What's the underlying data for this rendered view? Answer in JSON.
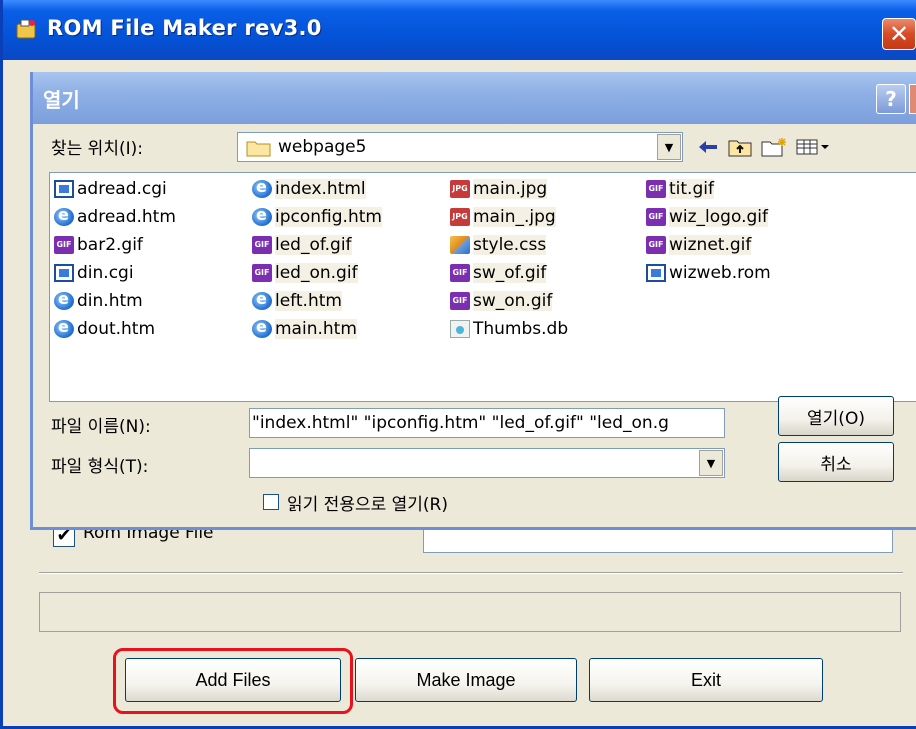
{
  "app": {
    "title": "ROM File Maker rev3.0"
  },
  "main": {
    "rom_image_label": "Rom Image File",
    "rom_image_checked": true,
    "rom_image_path": "",
    "status_text": "",
    "buttons": {
      "add_files": "Add Files",
      "make_image": "Make Image",
      "exit": "Exit"
    }
  },
  "dialog": {
    "title": "열기",
    "help_label": "?",
    "look_in_label": "찾는 위치(I):",
    "look_in_value": "webpage5",
    "file_columns": [
      [
        {
          "name": "adread.cgi",
          "type": "cgi",
          "selected": false
        },
        {
          "name": "adread.htm",
          "type": "htm",
          "selected": false
        },
        {
          "name": "bar2.gif",
          "type": "gif",
          "selected": false
        },
        {
          "name": "din.cgi",
          "type": "cgi",
          "selected": false
        },
        {
          "name": "din.htm",
          "type": "htm",
          "selected": false
        },
        {
          "name": "dout.htm",
          "type": "htm",
          "selected": false
        }
      ],
      [
        {
          "name": "index.html",
          "type": "htm",
          "selected": true
        },
        {
          "name": "ipconfig.htm",
          "type": "htm",
          "selected": true
        },
        {
          "name": "led_of.gif",
          "type": "gif",
          "selected": true
        },
        {
          "name": "led_on.gif",
          "type": "gif",
          "selected": true
        },
        {
          "name": "left.htm",
          "type": "htm",
          "selected": true
        },
        {
          "name": "main.htm",
          "type": "htm",
          "selected": true
        }
      ],
      [
        {
          "name": "main.jpg",
          "type": "jpg",
          "selected": true
        },
        {
          "name": "main_.jpg",
          "type": "jpg",
          "selected": true
        },
        {
          "name": "style.css",
          "type": "css",
          "selected": true
        },
        {
          "name": "sw_of.gif",
          "type": "gif",
          "selected": true
        },
        {
          "name": "sw_on.gif",
          "type": "gif",
          "selected": true
        },
        {
          "name": "Thumbs.db",
          "type": "db",
          "selected": false
        }
      ],
      [
        {
          "name": "tit.gif",
          "type": "gif",
          "selected": true
        },
        {
          "name": "wiz_logo.gif",
          "type": "gif",
          "selected": true
        },
        {
          "name": "wiznet.gif",
          "type": "gif",
          "selected": true
        },
        {
          "name": "wizweb.rom",
          "type": "rom",
          "selected": false
        }
      ]
    ],
    "file_name_label": "파일 이름(N):",
    "file_name_value": "\"index.html\" \"ipconfig.htm\" \"led_of.gif\" \"led_on.g",
    "file_type_label": "파일 형식(T):",
    "file_type_value": "",
    "open_button": "열기(O)",
    "cancel_button": "취소",
    "read_only_label": "읽기 전용으로 열기(R)",
    "read_only_checked": false
  },
  "icon_map": {
    "gif": "GIF",
    "jpg": "JPG"
  },
  "colors": {
    "titlebar": "#0453d8",
    "dialog_titlebar": "#8fb0e6",
    "highlight": "#e8111c"
  }
}
